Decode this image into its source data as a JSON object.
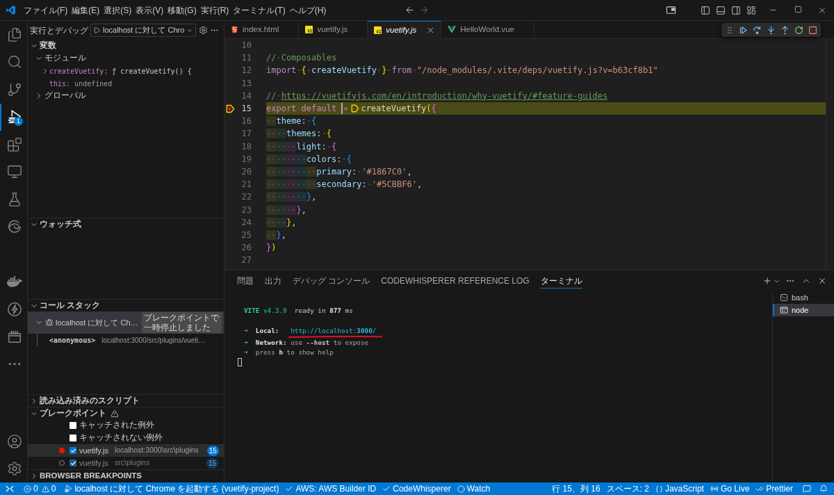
{
  "title_bar": {
    "menu": [
      "ファイル(F)",
      "編集(E)",
      "選択(S)",
      "表示(V)",
      "移動(G)",
      "実行(R)",
      "ターミナル(T)",
      "ヘルプ(H)"
    ]
  },
  "activity_bar": {
    "items": [
      {
        "selected": false
      },
      {
        "selected": false
      },
      {
        "selected": false
      },
      {
        "selected": true,
        "badge": "1"
      },
      {
        "selected": false
      },
      {
        "selected": false
      },
      {
        "selected": false
      },
      {
        "selected": false
      },
      {
        "selected": false
      },
      {
        "selected": false
      },
      {
        "selected": false
      },
      {
        "selected": false
      }
    ]
  },
  "sidebar": {
    "title": "実行とデバッグ",
    "launch_config": "localhost に対して Chro",
    "variables": {
      "title": "変数",
      "expanded": true,
      "scopes": [
        {
          "label": "モジュール",
          "expanded": true,
          "children": [
            {
              "name": "createVuetify:",
              "value": "ƒ createVuetify() {",
              "expanded": false
            },
            {
              "name": "this:",
              "value": "undefined"
            }
          ]
        },
        {
          "label": "グローバル",
          "expanded": false
        }
      ]
    },
    "watch": {
      "title": "ウォッチ式",
      "expanded": true
    },
    "call_stack": {
      "title": "コール スタック",
      "expanded": true,
      "threads": [
        {
          "name": "localhost に対して Ch…",
          "status": "ブレークポイントで一時停止しました",
          "expanded": true,
          "selected": true,
          "frames": [
            {
              "name": "<anonymous>",
              "location": "localhost:3000/src/plugins/vueti…"
            }
          ]
        }
      ]
    },
    "loaded_scripts": {
      "title": "読み込み済みのスクリプト",
      "expanded": false
    },
    "breakpoints": {
      "title": "ブレークポイント",
      "expanded": true,
      "warning": true,
      "items": [
        {
          "kind": "exception",
          "label": "キャッチされた例外",
          "checked": false
        },
        {
          "kind": "exception",
          "label": "キャッチされない例外",
          "checked": false
        },
        {
          "kind": "file",
          "file": "vuetify.js",
          "path": "localhost:3000\\src\\plugins",
          "line": "15",
          "checked": true,
          "verified": true,
          "selected": true
        },
        {
          "kind": "file",
          "file": "vuetify.js",
          "path": "src\\plugins",
          "line": "15",
          "checked": true,
          "verified": false,
          "selected": false
        }
      ]
    },
    "browser_breakpoints": {
      "title": "BROWSER BREAKPOINTS",
      "expanded": false
    }
  },
  "editor": {
    "tabs": [
      {
        "label": "index.html",
        "kind": "html",
        "selected": false,
        "preview": false
      },
      {
        "label": "vuetify.js",
        "kind": "js",
        "selected": false,
        "preview": false
      },
      {
        "label": "vuetify.js",
        "kind": "js",
        "selected": true,
        "preview": true
      },
      {
        "label": "HelloWorld.vue",
        "kind": "vue",
        "selected": false,
        "preview": false
      }
    ],
    "lines": [
      {
        "number": "10",
        "current": false,
        "breakpoint": false
      },
      {
        "number": "11",
        "current": false,
        "breakpoint": false,
        "tokens": [
          {
            "kind": "comment",
            "text": "// Composables"
          }
        ]
      },
      {
        "number": "12",
        "current": false,
        "breakpoint": false,
        "tokens": [
          {
            "kind": "keyword",
            "text": "import "
          },
          {
            "kind": "bracket1",
            "text": "{"
          },
          {
            "kind": "variable",
            "text": " createVuetify "
          },
          {
            "kind": "bracket1",
            "text": "}"
          },
          {
            "kind": "keyword",
            "text": " from "
          },
          {
            "kind": "string",
            "text": "\"/node_modules/.vite/deps/vuetify.js?v=b63cf8b1\""
          }
        ]
      },
      {
        "number": "13",
        "current": false,
        "breakpoint": false
      },
      {
        "number": "14",
        "current": false,
        "breakpoint": false,
        "tokens": [
          {
            "kind": "comment",
            "text": "// "
          },
          {
            "kind": "link",
            "text": "https://vuetifyjs.com/en/introduction/why-vuetify/#feature-guides"
          }
        ]
      },
      {
        "number": "15",
        "current": true,
        "breakpoint": true,
        "tokens": [
          {
            "kind": "keyword",
            "text": "export default "
          },
          {
            "kind": "cursor"
          },
          {
            "kind": "breakpoint_candidate"
          },
          {
            "kind": "stop_marker"
          },
          {
            "kind": "function",
            "text": "createVuetify"
          },
          {
            "kind": "bracket1",
            "text": "("
          },
          {
            "kind": "bracket2",
            "text": "{"
          }
        ]
      },
      {
        "number": "16",
        "current": false,
        "breakpoint": false,
        "tokens": [
          {
            "kind": "variable",
            "text": "  theme"
          },
          {
            "kind": "punct",
            "text": ": "
          },
          {
            "kind": "bracket3",
            "text": "{"
          }
        ]
      },
      {
        "number": "17",
        "current": false,
        "breakpoint": false,
        "tokens": [
          {
            "kind": "variable",
            "text": "    themes"
          },
          {
            "kind": "punct",
            "text": ": "
          },
          {
            "kind": "bracket1",
            "text": "{"
          }
        ]
      },
      {
        "number": "18",
        "current": false,
        "breakpoint": false,
        "tokens": [
          {
            "kind": "variable",
            "text": "      light"
          },
          {
            "kind": "punct",
            "text": ": "
          },
          {
            "kind": "bracket2",
            "text": "{"
          }
        ]
      },
      {
        "number": "19",
        "current": false,
        "breakpoint": false,
        "tokens": [
          {
            "kind": "variable",
            "text": "        colors"
          },
          {
            "kind": "punct",
            "text": ": "
          },
          {
            "kind": "bracket3",
            "text": "{"
          }
        ]
      },
      {
        "number": "20",
        "current": false,
        "breakpoint": false,
        "tokens": [
          {
            "kind": "variable",
            "text": "          primary"
          },
          {
            "kind": "punct",
            "text": ": "
          },
          {
            "kind": "string",
            "text": "'#1867C0'"
          },
          {
            "kind": "punct",
            "text": ","
          }
        ]
      },
      {
        "number": "21",
        "current": false,
        "breakpoint": false,
        "tokens": [
          {
            "kind": "variable",
            "text": "          secondary"
          },
          {
            "kind": "punct",
            "text": ": "
          },
          {
            "kind": "string",
            "text": "'#5CBBF6'"
          },
          {
            "kind": "punct",
            "text": ","
          }
        ]
      },
      {
        "number": "22",
        "current": false,
        "breakpoint": false,
        "tokens": [
          {
            "kind": "bracket3",
            "text": "        }"
          },
          {
            "kind": "punct",
            "text": ","
          }
        ]
      },
      {
        "number": "23",
        "current": false,
        "breakpoint": false,
        "tokens": [
          {
            "kind": "bracket2",
            "text": "      }"
          },
          {
            "kind": "punct",
            "text": ","
          }
        ]
      },
      {
        "number": "24",
        "current": false,
        "breakpoint": false,
        "tokens": [
          {
            "kind": "bracket1",
            "text": "    }"
          },
          {
            "kind": "punct",
            "text": ","
          }
        ]
      },
      {
        "number": "25",
        "current": false,
        "breakpoint": false,
        "tokens": [
          {
            "kind": "bracket3",
            "text": "  }"
          },
          {
            "kind": "punct",
            "text": ","
          }
        ]
      },
      {
        "number": "26",
        "current": false,
        "breakpoint": false,
        "tokens": [
          {
            "kind": "bracket2",
            "text": "}"
          },
          {
            "kind": "bracket1",
            "text": ")"
          }
        ]
      },
      {
        "number": "27",
        "current": false,
        "breakpoint": false
      }
    ]
  },
  "panel": {
    "tabs": [
      {
        "label": "問題",
        "selected": false
      },
      {
        "label": "出力",
        "selected": false
      },
      {
        "label": "デバッグ コンソール",
        "selected": false
      },
      {
        "label": "CODEWHISPERER REFERENCE LOG",
        "selected": false
      },
      {
        "label": "ターミナル",
        "selected": true
      }
    ],
    "terminal": {
      "blocks": [
        {
          "lines": [
            {
              "underlined": false,
              "tokens": [
                {
                  "kind": "brand",
                  "text": "VITE"
                },
                {
                  "kind": "brand_version",
                  "text": " v4.3.9"
                },
                {
                  "kind": "plain",
                  "text": "  ready in "
                },
                {
                  "kind": "bold",
                  "text": "877"
                },
                {
                  "kind": "plain",
                  "text": " ms"
                }
              ]
            }
          ]
        },
        {
          "lines": [
            {
              "underlined": true,
              "tokens": [
                {
                  "kind": "arrow",
                  "text": "➜"
                },
                {
                  "kind": "bold",
                  "text": "  Local:   "
                },
                {
                  "kind": "link",
                  "text": "http://localhost:**3000**/"
                }
              ]
            },
            {
              "underlined": false,
              "tokens": [
                {
                  "kind": "arrow",
                  "text": "➜"
                },
                {
                  "kind": "bold",
                  "text": "  Network:"
                },
                {
                  "kind": "dim",
                  "text": " use "
                },
                {
                  "kind": "dim_bold",
                  "text": "--host"
                },
                {
                  "kind": "dim",
                  "text": " to expose"
                }
              ]
            },
            {
              "underlined": false,
              "tokens": [
                {
                  "kind": "arrow",
                  "text": "➜"
                },
                {
                  "kind": "dim",
                  "text": "  press "
                },
                {
                  "kind": "bold",
                  "text": "h"
                },
                {
                  "kind": "dim",
                  "text": " to show help"
                }
              ]
            }
          ]
        }
      ]
    },
    "terminal_list": [
      {
        "label": "bash",
        "kind": "shell",
        "selected": false
      },
      {
        "label": "node",
        "kind": "console",
        "selected": true
      }
    ]
  },
  "status_bar": {
    "problems": {
      "errors": "0",
      "warnings": "0"
    },
    "left": [
      {
        "kind": "debug",
        "text": "localhost に対して Chrome を起動する (vuetify-project)"
      },
      {
        "kind": "check",
        "text": "AWS: AWS Builder ID"
      },
      {
        "kind": "check",
        "text": "CodeWhisperer"
      },
      {
        "kind": "circle",
        "text": "Watch"
      }
    ],
    "right": [
      {
        "kind": "plain",
        "text": "行 15、列 16"
      },
      {
        "kind": "plain",
        "text": "スペース: 2"
      },
      {
        "kind": "braces",
        "text": "JavaScript"
      },
      {
        "kind": "broadcast",
        "text": "Go Live"
      },
      {
        "kind": "double_check",
        "text": "Prettier"
      }
    ]
  }
}
